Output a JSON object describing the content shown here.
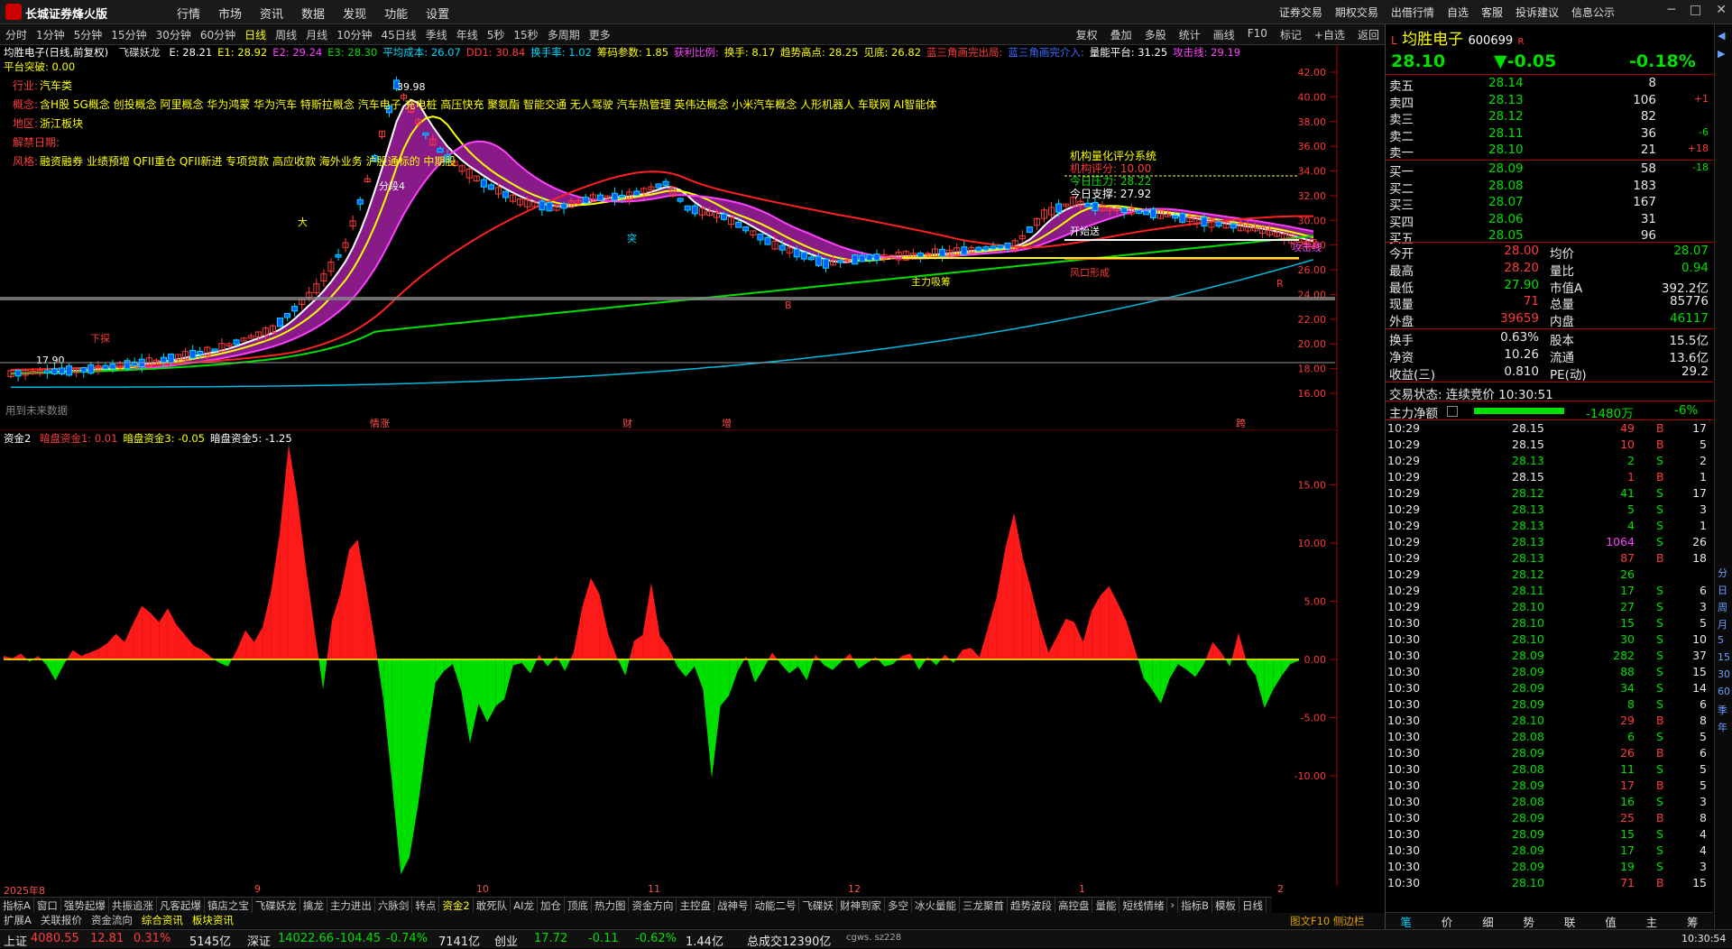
{
  "window": {
    "app_title": "长城证券烽火版",
    "menu": [
      "行情",
      "市场",
      "资讯",
      "数据",
      "发现",
      "功能",
      "设置"
    ],
    "right_links": [
      "证券交易",
      "期权交易",
      "出借行情",
      "自选",
      "客服",
      "投诉建议",
      "信息公示"
    ],
    "win_buttons": [
      "─",
      "□",
      "✕"
    ]
  },
  "toolbar": {
    "periods": [
      "分时",
      "1分钟",
      "5分钟",
      "15分钟",
      "30分钟",
      "60分钟",
      "日线",
      "周线",
      "月线",
      "10分钟",
      "45日线",
      "季线",
      "年线",
      "5秒",
      "15秒",
      "多周期",
      "更多"
    ],
    "active_period": "日线",
    "tools": [
      "复权",
      "叠加",
      "多股",
      "统计",
      "画线",
      "F10",
      "标记",
      "+自选",
      "返回"
    ]
  },
  "main_chart": {
    "title": "均胜电子(日线,前复权)",
    "indicator_name": "飞碟妖龙",
    "header_values": [
      {
        "text": "E: 28.21",
        "color": "#ffffff"
      },
      {
        "text": "E1: 28.92",
        "color": "#ffff00"
      },
      {
        "text": "E2: 29.24",
        "color": "#ff40ff"
      },
      {
        "text": "E3: 28.30",
        "color": "#00e000"
      },
      {
        "text": "平均成本: 26.07",
        "color": "#00d8ff"
      },
      {
        "text": "DD1: 30.84",
        "color": "#ff3b3b"
      },
      {
        "text": "换手率: 1.02",
        "color": "#00d8ff"
      },
      {
        "text": "筹码参数: 1.85",
        "color": "#ffff00"
      },
      {
        "text": "获利比例:",
        "color": "#ff40ff"
      },
      {
        "text": "换手: 8.17",
        "color": "#ffff00"
      },
      {
        "text": "趋势高点: 28.25",
        "color": "#ffff00"
      },
      {
        "text": "见底: 26.82",
        "color": "#ffff00"
      },
      {
        "text": "蓝三角画完出局:",
        "color": "#ff3b3b"
      },
      {
        "text": "蓝三角画完介入:",
        "color": "#3b6bff"
      },
      {
        "text": "量能平台: 31.25",
        "color": "#ffffff"
      },
      {
        "text": "攻击线: 29.19",
        "color": "#ff40ff"
      }
    ],
    "platform_break": "平台突破: 0.00",
    "info_lines": [
      {
        "label": "行业:",
        "value": "汽车类"
      },
      {
        "label": "概念:",
        "value": "含H股 5G概念 创投概念 阿里概念 华为鸿蒙 华为汽车 特斯拉概念 汽车电子 充电桩 高压快充 聚氨酯 智能交通 无人驾驶 汽车热管理 英伟达概念 小米汽车概念 人形机器人 车联网 AI智能体"
      },
      {
        "label": "地区:",
        "value": "浙江板块"
      },
      {
        "label": "解禁日期:",
        "value": ""
      },
      {
        "label": "风格:",
        "value": "融资融券 业绩预增 QFII重仓 QFII新进 专项贷款 高应收款 海外业务 沪股通标的 中期股"
      }
    ],
    "system_box": {
      "title": "机构量化评分系统",
      "score": "机构评分: 10.00",
      "pressure": "今日压力: 28.22",
      "support": "今日支撑: 27.92"
    },
    "annotations": [
      "39.98",
      "17.90",
      "攻击线",
      "主力吸筹",
      "风口形成",
      "开始送",
      "分段4",
      "大",
      "B",
      "R",
      "突",
      "下探"
    ],
    "y_axis": [
      "42.00",
      "40.00",
      "38.00",
      "36.00",
      "34.00",
      "32.00",
      "30.00",
      "28.00",
      "26.00",
      "24.00",
      "22.00",
      "20.00",
      "18.00",
      "16.00"
    ],
    "footer_note": "用到未来数据",
    "event_marks": [
      "情涨",
      "财",
      "增",
      "跨"
    ]
  },
  "sub_chart": {
    "name": "资金2",
    "values": [
      {
        "text": "暗盘资金1: 0.01",
        "color": "#ff3b3b"
      },
      {
        "text": "暗盘资金3: -0.05",
        "color": "#ffff00"
      },
      {
        "text": "暗盘资金5: -1.25",
        "color": "#ffffff"
      }
    ],
    "y_axis": [
      "15.00",
      "10.00",
      "5.00",
      "0.00",
      "-5.00",
      "-10.00"
    ]
  },
  "chart_data": {
    "type": "area",
    "name": "资金2",
    "ylim": [
      -19,
      19
    ],
    "values": [
      0.3,
      0.1,
      0.5,
      -0.2,
      0.3,
      -0.5,
      -1.8,
      -0.4,
      0.8,
      0.3,
      0.6,
      0.9,
      1.4,
      2.2,
      1.5,
      3.1,
      4.6,
      4.0,
      3.2,
      4.4,
      3.0,
      2.1,
      1.2,
      0.8,
      0.2,
      -0.3,
      -0.6,
      0.8,
      2.5,
      1.5,
      2.8,
      6.0,
      11.0,
      18.5,
      14.0,
      8.0,
      2.6,
      -2.6,
      3.3,
      5.7,
      9.4,
      10.3,
      6.1,
      1.5,
      -3.6,
      -10.8,
      -18.5,
      -17.0,
      -12.5,
      -7.0,
      -2.0,
      -1.0,
      -0.4,
      -2.7,
      -7.2,
      -3.8,
      -5.4,
      -4.0,
      -3.4,
      -0.5,
      -0.3,
      -1.2,
      0.4,
      -0.6,
      0.3,
      -1.0,
      0.6,
      4.5,
      7.0,
      5.6,
      2.2,
      0.2,
      -1.4,
      1.6,
      2.1,
      6.6,
      2.0,
      1.0,
      -0.6,
      -1.5,
      -0.6,
      -2.6,
      -10.2,
      -4.0,
      -3.1,
      -1.0,
      0.3,
      -2.0,
      -0.8,
      0.6,
      -0.4,
      -1.2,
      -0.6,
      -1.8,
      0.4,
      -0.5,
      -0.9,
      -0.2,
      0.5,
      -0.8,
      -0.3,
      0.2,
      -0.6,
      -0.4,
      0.3,
      0.5,
      -0.9,
      0.2,
      -0.5,
      0.4,
      -0.3,
      0.8,
      1.0,
      0.2,
      2.8,
      5.4,
      9.6,
      12.6,
      8.8,
      6.0,
      3.0,
      0.6,
      2.0,
      3.5,
      3.2,
      1.5,
      4.2,
      5.5,
      6.3,
      4.9,
      3.3,
      0.9,
      -1.6,
      -2.6,
      -3.8,
      -1.7,
      -0.4,
      -0.9,
      -1.5,
      -0.4,
      1.5,
      0.6,
      -0.6,
      2.3,
      -0.4,
      -1.4,
      -4.2,
      -2.6,
      -1.4,
      -0.4,
      -0.1
    ]
  },
  "date_axis": [
    "2025年8",
    "9",
    "10",
    "11",
    "12",
    "1",
    "2"
  ],
  "indicator_tabs": [
    "指标A",
    "窗口",
    "强势起爆",
    "共振追涨",
    "凡客起爆",
    "镇店之宝",
    "飞碟妖龙",
    "擒龙",
    "主力进出",
    "六脉剑",
    "转点",
    "资金2",
    "敢死队",
    "AI龙",
    "加仓",
    "顶底",
    "热力图",
    "资金方向",
    "主控盘",
    "战神号",
    "动能二号",
    "飞碟妖",
    "财神到家",
    "多空",
    "冰火量能",
    "三龙聚首",
    "趋势波段",
    "高控盘",
    "量能",
    "短线情绪",
    "›",
    "指标B",
    "模板",
    "日线"
  ],
  "active_indicator_tab": "资金2",
  "bottom_tabs": [
    "扩展A",
    "关联报价",
    "资金流向",
    "综合资讯",
    "板块资讯"
  ],
  "bottom_right_note": "图文F10 侧边栏",
  "right_panel": {
    "name": "均胜电子",
    "code": "600699",
    "flag": "R",
    "price": "28.10",
    "change": "▼-0.05",
    "change_pct": "-0.18%",
    "asks": [
      {
        "label": "卖五",
        "price": "28.14",
        "vol": "8",
        "delta": ""
      },
      {
        "label": "卖四",
        "price": "28.13",
        "vol": "106",
        "delta": "+1"
      },
      {
        "label": "卖三",
        "price": "28.12",
        "vol": "82",
        "delta": ""
      },
      {
        "label": "卖二",
        "price": "28.11",
        "vol": "36",
        "delta": "-6"
      },
      {
        "label": "卖一",
        "price": "28.10",
        "vol": "21",
        "delta": "+18"
      }
    ],
    "bids": [
      {
        "label": "买一",
        "price": "28.09",
        "vol": "58",
        "delta": "-18"
      },
      {
        "label": "买二",
        "price": "28.08",
        "vol": "183",
        "delta": ""
      },
      {
        "label": "买三",
        "price": "28.07",
        "vol": "167",
        "delta": ""
      },
      {
        "label": "买四",
        "price": "28.06",
        "vol": "31",
        "delta": ""
      },
      {
        "label": "买五",
        "price": "28.05",
        "vol": "96",
        "delta": ""
      }
    ],
    "stats": [
      {
        "l1": "今开",
        "v1": "28.00",
        "c1": "red",
        "l2": "均价",
        "v2": "28.07",
        "c2": "green"
      },
      {
        "l1": "最高",
        "v1": "28.20",
        "c1": "red",
        "l2": "量比",
        "v2": "0.94",
        "c2": "green"
      },
      {
        "l1": "最低",
        "v1": "27.90",
        "c1": "green",
        "l2": "市值A",
        "v2": "392.2亿",
        "c2": "white"
      },
      {
        "l1": "现量",
        "v1": "71",
        "c1": "red",
        "l2": "总量",
        "v2": "85776",
        "c2": "white"
      },
      {
        "l1": "外盘",
        "v1": "39659",
        "c1": "red",
        "l2": "内盘",
        "v2": "46117",
        "c2": "green"
      }
    ],
    "stats2": [
      {
        "l1": "换手",
        "v1": "0.63%",
        "l2": "股本",
        "v2": "15.5亿"
      },
      {
        "l1": "净资",
        "v1": "10.26",
        "l2": "流通",
        "v2": "13.6亿"
      },
      {
        "l1": "收益(三)",
        "v1": "0.810",
        "l2": "PE(动)",
        "v2": "29.2"
      }
    ],
    "trade_status": "交易状态: 连续竞价 10:30:51",
    "main_flow_label": "主力净额",
    "main_flow_value": "-1480万",
    "main_flow_pct": "-6%",
    "ticks": [
      [
        "10:29",
        "28.15",
        "49",
        "B",
        "17"
      ],
      [
        "10:29",
        "28.15",
        "10",
        "B",
        "5"
      ],
      [
        "10:29",
        "28.13",
        "2",
        "S",
        "2"
      ],
      [
        "10:29",
        "28.15",
        "1",
        "B",
        "1"
      ],
      [
        "10:29",
        "28.12",
        "41",
        "S",
        "17"
      ],
      [
        "10:29",
        "28.13",
        "5",
        "S",
        "3"
      ],
      [
        "10:29",
        "28.13",
        "4",
        "S",
        "1"
      ],
      [
        "10:29",
        "28.13",
        "1064",
        "S",
        "26"
      ],
      [
        "10:29",
        "28.13",
        "87",
        "B",
        "18"
      ],
      [
        "10:29",
        "28.12",
        "26",
        "",
        ""
      ],
      [
        "10:29",
        "28.11",
        "17",
        "S",
        "6"
      ],
      [
        "10:29",
        "28.10",
        "27",
        "S",
        "3"
      ],
      [
        "10:30",
        "28.10",
        "15",
        "S",
        "5"
      ],
      [
        "10:30",
        "28.10",
        "30",
        "S",
        "10"
      ],
      [
        "10:30",
        "28.09",
        "282",
        "S",
        "37"
      ],
      [
        "10:30",
        "28.09",
        "88",
        "S",
        "15"
      ],
      [
        "10:30",
        "28.09",
        "34",
        "S",
        "14"
      ],
      [
        "10:30",
        "28.09",
        "8",
        "S",
        "6"
      ],
      [
        "10:30",
        "28.10",
        "29",
        "B",
        "8"
      ],
      [
        "10:30",
        "28.08",
        "6",
        "S",
        "5"
      ],
      [
        "10:30",
        "28.09",
        "26",
        "B",
        "6"
      ],
      [
        "10:30",
        "28.08",
        "11",
        "S",
        "5"
      ],
      [
        "10:30",
        "28.09",
        "17",
        "B",
        "5"
      ],
      [
        "10:30",
        "28.08",
        "16",
        "S",
        "3"
      ],
      [
        "10:30",
        "28.09",
        "25",
        "B",
        "8"
      ],
      [
        "10:30",
        "28.09",
        "15",
        "S",
        "4"
      ],
      [
        "10:30",
        "28.09",
        "17",
        "S",
        "4"
      ],
      [
        "10:30",
        "28.09",
        "19",
        "S",
        "3"
      ],
      [
        "10:30",
        "28.10",
        "71",
        "B",
        "15"
      ]
    ],
    "tabs": [
      "笔",
      "价",
      "细",
      "势",
      "联",
      "值",
      "主",
      "筹"
    ]
  },
  "right_sidebar": [
    "◀",
    "▶",
    "分",
    "日",
    "周",
    "月",
    "5",
    "15",
    "30",
    "60",
    "季",
    "年"
  ],
  "status_bar": {
    "sh_label": "上证",
    "sh_val": "4080.55",
    "sh_chg": "12.81",
    "sh_pct": "0.31%",
    "sh_amt": "5145亿",
    "sz_label": "深证",
    "sz_val": "14022.66",
    "sz_chg": "-104.45",
    "sz_pct": "-0.74%",
    "sz_amt": "7141亿",
    "cy_label": "创业",
    "cy_val": "17.72",
    "cy_chg": "-0.11",
    "cy_pct": "-0.62%",
    "cy_amt": "1.44亿",
    "total": "总成交12390亿",
    "server": "cgws. sz228",
    "time": "10:30:54"
  }
}
